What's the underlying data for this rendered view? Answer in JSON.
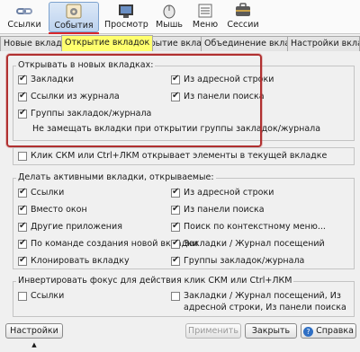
{
  "toolbar": {
    "items": [
      {
        "label": "Ссылки",
        "icon": "link-icon"
      },
      {
        "label": "События",
        "icon": "events-gear-icon"
      },
      {
        "label": "Просмотр",
        "icon": "view-icon"
      },
      {
        "label": "Мышь",
        "icon": "mouse-icon"
      },
      {
        "label": "Меню",
        "icon": "menu-icon"
      },
      {
        "label": "Сессии",
        "icon": "sessions-icon"
      }
    ]
  },
  "tabs": [
    "Новые вкладки",
    "Открытие вкладок",
    "Закрытие вкладок",
    "Объединение вкладок",
    "Настройки вклад"
  ],
  "group1": {
    "title": "Открывать в новых вкладках:",
    "left": [
      {
        "label": "Закладки",
        "checked": true
      },
      {
        "label": "Ссылки из журнала",
        "checked": true
      },
      {
        "label": "Группы закладок/журнала",
        "checked": true
      }
    ],
    "right": [
      {
        "label": "Из адресной строки",
        "checked": true
      },
      {
        "label": "Из панели поиска",
        "checked": true
      }
    ],
    "sub_option": {
      "label": "Не замещать вкладки при открытии группы закладок/журнала",
      "checked": false
    }
  },
  "single_option": {
    "label": "Клик СКМ или Ctrl+ЛКМ открывает элементы в текущей вкладке",
    "checked": false
  },
  "group2": {
    "title": "Делать активными вкладки, открываемые:",
    "left": [
      {
        "label": "Ссылки",
        "checked": true
      },
      {
        "label": "Вместо окон",
        "checked": true
      },
      {
        "label": "Другие приложения",
        "checked": true
      },
      {
        "label": "По команде создания новой вкладки",
        "checked": true
      },
      {
        "label": "Клонировать вкладку",
        "checked": true
      }
    ],
    "right": [
      {
        "label": "Из адресной строки",
        "checked": true
      },
      {
        "label": "Из панели поиска",
        "checked": true
      },
      {
        "label": "Поиск по контекстному меню...",
        "checked": true
      },
      {
        "label": "Закладки / Журнал посещений",
        "checked": true
      },
      {
        "label": "Группы закладок/журнала",
        "checked": true
      }
    ]
  },
  "group3": {
    "title": "Инвертировать фокус для действия клик СКМ или Ctrl+ЛКМ",
    "left": [
      {
        "label": "Ссылки",
        "checked": false
      }
    ],
    "right": [
      {
        "label": "Закладки / Журнал посещений, Из",
        "label2": "адресной строки, Из панели поиска",
        "checked": false
      }
    ]
  },
  "footer": {
    "settings": "Настройки",
    "apply": "Применить",
    "close": "Закрыть",
    "help": "Справка"
  },
  "colors": {
    "highlight_border": "#b03030",
    "active_tab": "#ffff6e",
    "active_tool_underline": "#d9262b"
  }
}
